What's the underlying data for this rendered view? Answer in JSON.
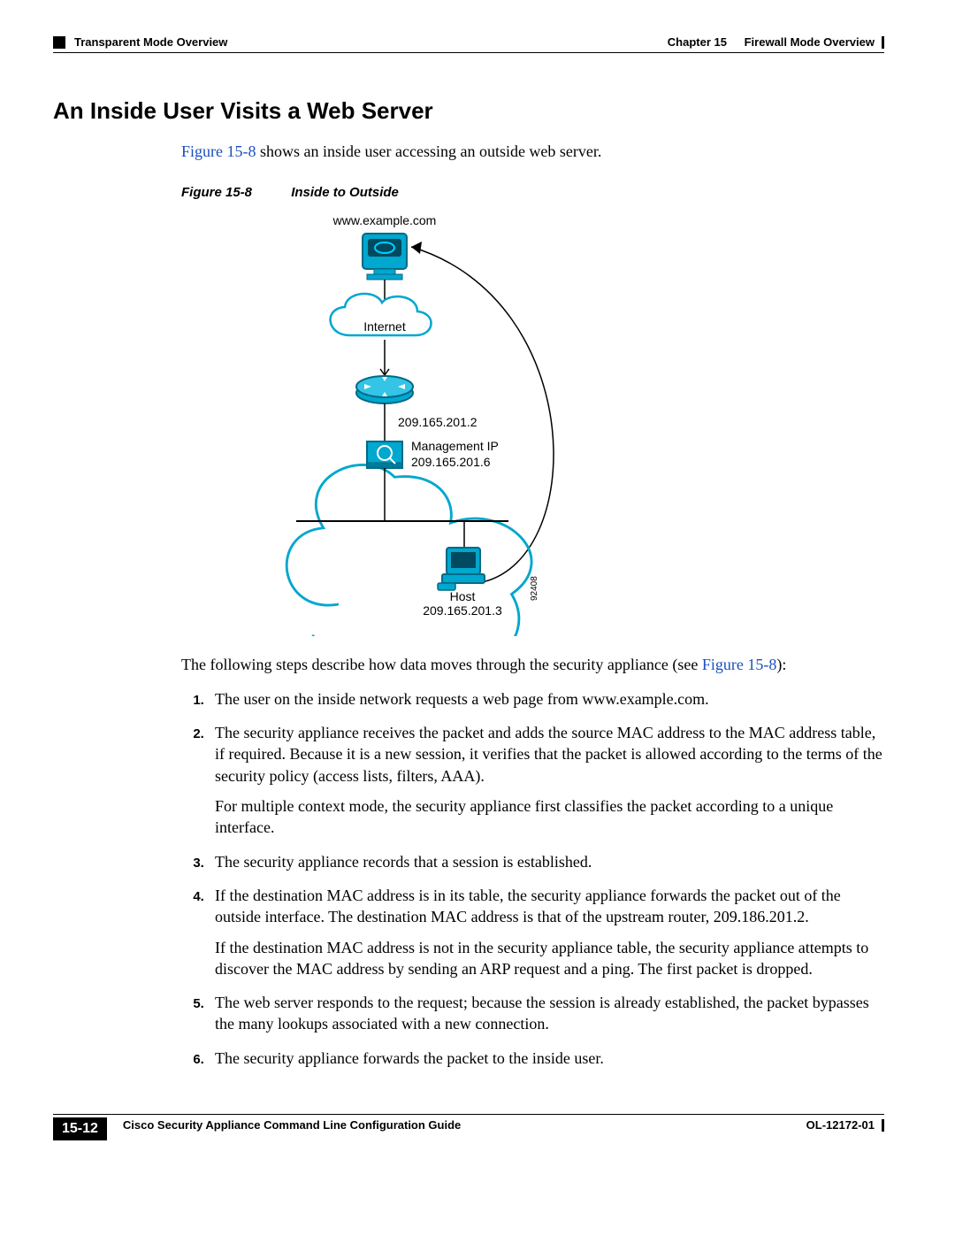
{
  "header": {
    "section": "Transparent Mode Overview",
    "chapter_label": "Chapter 15",
    "chapter_title": "Firewall Mode Overview"
  },
  "title": "An Inside User Visits a Web Server",
  "intro": {
    "fig_ref": "Figure 15-8",
    "rest": " shows an inside user accessing an outside web server."
  },
  "figure": {
    "number": "Figure 15-8",
    "caption": "Inside to Outside",
    "labels": {
      "server": "www.example.com",
      "internet": "Internet",
      "router_ip": "209.165.201.2",
      "mgmt_label": "Management IP",
      "mgmt_ip": "209.165.201.6",
      "host_label": "Host",
      "host_ip": "209.165.201.3",
      "side_id": "92408"
    }
  },
  "para_before_steps": {
    "text": "The following steps describe how data moves through the security appliance (see ",
    "fig_ref": "Figure 15-8",
    "close": "):"
  },
  "steps": [
    {
      "p": [
        "The user on the inside network requests a web page from www.example.com."
      ]
    },
    {
      "p": [
        "The security appliance receives the packet and adds the source MAC address to the MAC address table, if required. Because it is a new session, it verifies that the packet is allowed according to the terms of the security policy (access lists, filters, AAA).",
        "For multiple context mode, the security appliance first classifies the packet according to a unique interface."
      ]
    },
    {
      "p": [
        "The security appliance records that a session is established."
      ]
    },
    {
      "p": [
        "If the destination MAC address is in its table, the security appliance forwards the packet out of the outside interface. The destination MAC address is that of the upstream router, 209.186.201.2.",
        "If the destination MAC address is not in the security appliance table, the security appliance attempts to discover the MAC address by sending an ARP request and a ping. The first packet is dropped."
      ]
    },
    {
      "p": [
        "The web server responds to the request; because the session is already established, the packet bypasses the many lookups associated with a new connection."
      ]
    },
    {
      "p": [
        "The security appliance forwards the packet to the inside user."
      ]
    }
  ],
  "footer": {
    "book_title": "Cisco Security Appliance Command Line Configuration Guide",
    "page_num": "15-12",
    "doc_id": "OL-12172-01"
  }
}
